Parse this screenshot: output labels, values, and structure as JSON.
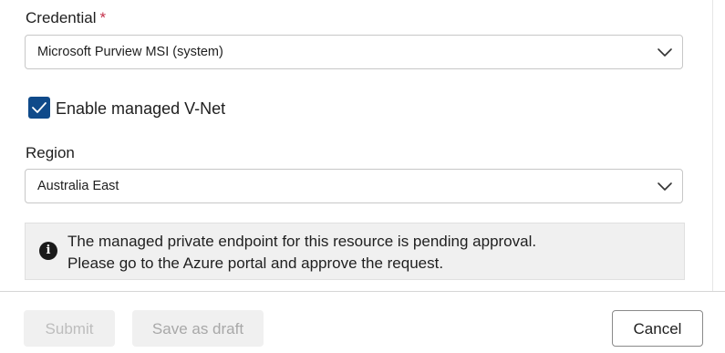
{
  "credential": {
    "label": "Credential",
    "required_marker": "*",
    "selected": "Microsoft Purview MSI (system)"
  },
  "vnet": {
    "label": "Enable managed V-Net",
    "checked": true
  },
  "region": {
    "label": "Region",
    "selected": "Australia East"
  },
  "info": {
    "line1": "The managed private endpoint for this resource is pending approval.",
    "line2": "Please go to the Azure portal and approve the request."
  },
  "footer": {
    "submit_label": "Submit",
    "draft_label": "Save as draft",
    "cancel_label": "Cancel"
  },
  "colors": {
    "checkbox_fill": "#0f4a8a",
    "required_marker": "#c4314b",
    "info_background": "#f0f0f0"
  },
  "icons": {
    "dropdown": "chevron-down-icon",
    "checkbox": "checkmark-icon",
    "info": "info-icon"
  }
}
